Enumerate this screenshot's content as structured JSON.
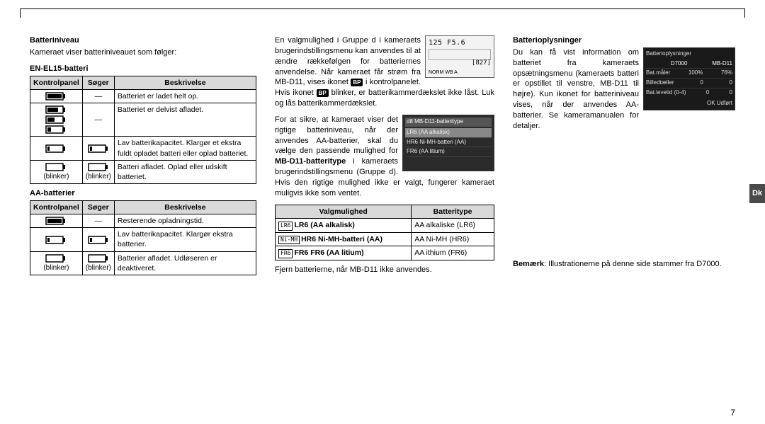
{
  "lang_tab": "Dk",
  "page_number": "7",
  "col1": {
    "title": "Batteriniveau",
    "intro": "Kameraet viser batteriniveauet som følger:",
    "en_el15_head": "EN-EL15-batteri",
    "tbl1": {
      "h1": "Kontrolpanel",
      "h2": "Søger",
      "h3": "Beskrivelse",
      "r1_desc": "Batteriet er ladet helt op.",
      "r1_sog": "—",
      "r2_desc": "Batteriet er delvist afladet.",
      "r2_sog": "—",
      "r3_desc": "Lav batterikapacitet. Klargør et ekstra fuldt opladet batteri eller oplad batteriet.",
      "r4_desc": "Batteri afladet. Oplad eller udskift batteriet.",
      "r4_blink": "(blinker)"
    },
    "aa_head": "AA-batterier",
    "tbl2": {
      "h1": "Kontrolpanel",
      "h2": "Søger",
      "h3": "Beskrivelse",
      "r1_desc": "Resterende opladningstid.",
      "r1_sog": "—",
      "r2_desc": "Lav batterikapacitet. Klargør ekstra batterier.",
      "r3_desc": "Batterier afladet. Udløseren er deaktiveret.",
      "r3_blink": "(blinker)"
    }
  },
  "col2": {
    "lcd": {
      "top": "125  F5.6",
      "count": "[827]",
      "norm": "NORM",
      "wb": "WB  A"
    },
    "para1a": "En valgmulighed i Gruppe d i kameraets brugerindstillingsmenu kan anvendes til at ændre rækkefølgen for batteriernes anvendelse. Når kameraet får strøm fra MB-D11, vises ikonet ",
    "para1b": " i kontrolpanelet. Hvis ikonet ",
    "para1c": " blinker, er batterikammerdækslet ikke låst. Luk og lås batterikammerdækslet.",
    "bp_icon": "BP",
    "menu": {
      "title": "d8 MB-D11-batteritype",
      "o1": "LR6 (AA alkalisk)",
      "o2": "HR6 Ni-MH-batteri (AA)",
      "o3": "FR6 (AA litium)"
    },
    "para2a": "For at sikre, at kameraet viser det rigtige batteriniveau, når der anvendes AA-batterier, skal du vælge den passende mulighed for ",
    "para2bold": "MB-D11-batteritype",
    "para2b": " i kameraets brugerindstillingsmenu (Gruppe d). Hvis den rigtige mulighed ikke er valgt, fungerer kameraet muligvis ikke som ventet.",
    "tbl": {
      "h1": "Valgmulighed",
      "h2": "Batteritype",
      "r1a_icon": "LR6",
      "r1a": "LR6 (AA alkalisk)",
      "r1b": "AA alkaliske (LR6)",
      "r2a_icon": "Ni-MH",
      "r2a": "HR6 Ni-MH-batteri (AA)",
      "r2b": "AA Ni-MH (HR6)",
      "r3a_icon": "FR6",
      "r3a": "FR6 FR6 (AA litium)",
      "r3b": "AA ithium (FR6)"
    },
    "footer": "Fjern batterierne, når MB-D11 ikke anvendes."
  },
  "col3": {
    "title": "Batterioplysninger",
    "info": {
      "title": "Batterioplysninger",
      "h1": "D7000",
      "h2": "MB-D11",
      "r1l": "Bat.måler",
      "r1a": "100%",
      "r1b": "76%",
      "r2l": "Billedtæller",
      "r2a": "0",
      "r2b": "0",
      "r3l": "Bat.levetid (0-4)",
      "r3a": "0",
      "r3b": "0",
      "ok": "OK Udført"
    },
    "para": "Du kan få vist information om batteriet fra kameraets opsætningsmenu (kameraets batteri er opstillet til venstre, MB-D11 til højre). Kun ikonet for batteriniveau vises, når der anvendes AA-batterier. Se kameramanualen for detaljer.",
    "note_label": "Bemærk",
    "note": ": Illustrationerne på denne side stammer fra D7000."
  }
}
